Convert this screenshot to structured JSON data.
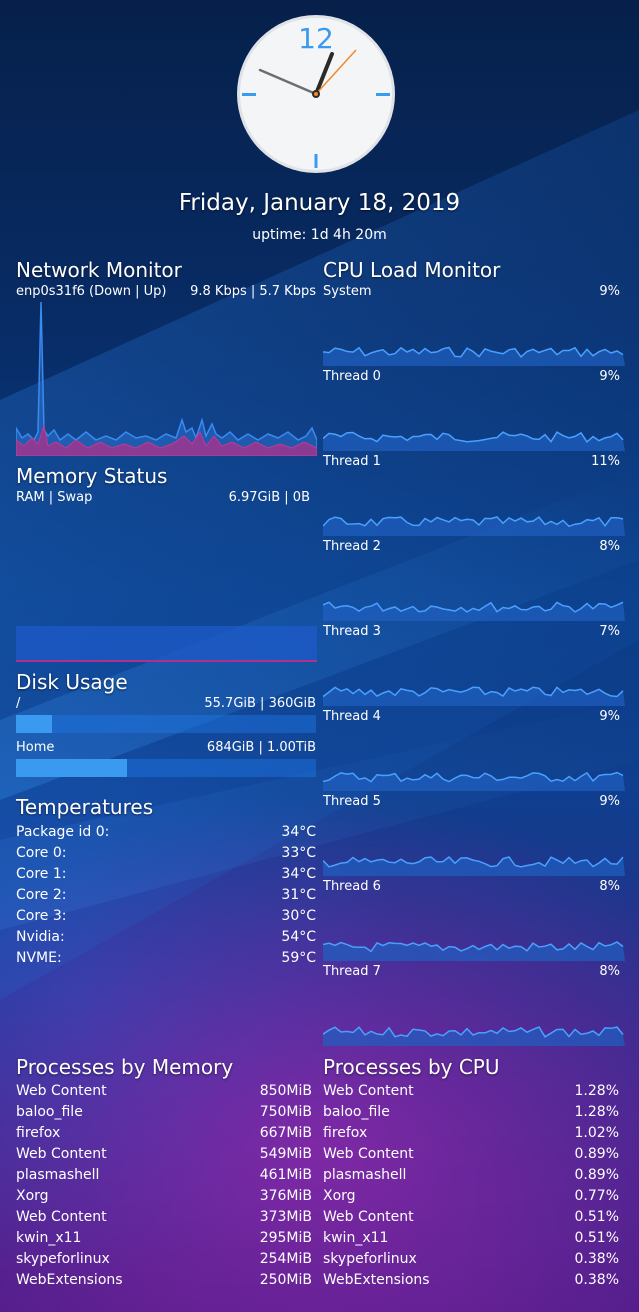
{
  "clock": {
    "numeral": "12"
  },
  "date": "Friday, January 18, 2019",
  "uptime": "uptime: 1d 4h 20m",
  "network": {
    "title": "Network Monitor",
    "interface": "enp0s31f6 (Down | Up)",
    "rates": "9.8 Kbps | 5.7 Kbps",
    "colors": {
      "down": "#3a8af0",
      "up": "#b0308a"
    }
  },
  "memory": {
    "title": "Memory Status",
    "label": "RAM | Swap",
    "value": "6.97GiB | 0B"
  },
  "disk": {
    "title": "Disk Usage",
    "items": [
      {
        "name": "/",
        "value": "55.7GiB | 360GiB",
        "fraction": 0.12
      },
      {
        "name": "Home",
        "value": "684GiB | 1.00TiB",
        "fraction": 0.37
      }
    ]
  },
  "temps": {
    "title": "Temperatures",
    "items": [
      {
        "name": "Package id 0:",
        "value": "34°C"
      },
      {
        "name": "Core 0:",
        "value": "33°C"
      },
      {
        "name": "Core 1:",
        "value": "34°C"
      },
      {
        "name": "Core 2:",
        "value": "31°C"
      },
      {
        "name": "Core 3:",
        "value": "30°C"
      },
      {
        "name": "Nvidia:",
        "value": "54°C"
      },
      {
        "name": "NVME:",
        "value": "59°C"
      }
    ]
  },
  "cpu": {
    "title": "CPU Load Monitor",
    "rows": [
      {
        "name": "System",
        "value": "9%"
      },
      {
        "name": "Thread 0",
        "value": "9%"
      },
      {
        "name": "Thread 1",
        "value": "11%"
      },
      {
        "name": "Thread 2",
        "value": "8%"
      },
      {
        "name": "Thread 3",
        "value": "7%"
      },
      {
        "name": "Thread 4",
        "value": "9%"
      },
      {
        "name": "Thread 5",
        "value": "9%"
      },
      {
        "name": "Thread 6",
        "value": "8%"
      },
      {
        "name": "Thread 7",
        "value": "8%"
      }
    ]
  },
  "proc_mem": {
    "title": "Processes by Memory",
    "items": [
      {
        "name": "Web Content",
        "value": "850MiB"
      },
      {
        "name": "baloo_file",
        "value": "750MiB"
      },
      {
        "name": "firefox",
        "value": "667MiB"
      },
      {
        "name": "Web Content",
        "value": "549MiB"
      },
      {
        "name": "plasmashell",
        "value": "461MiB"
      },
      {
        "name": "Xorg",
        "value": "376MiB"
      },
      {
        "name": "Web Content",
        "value": "373MiB"
      },
      {
        "name": "kwin_x11",
        "value": "295MiB"
      },
      {
        "name": "skypeforlinux",
        "value": "254MiB"
      },
      {
        "name": "WebExtensions",
        "value": "250MiB"
      }
    ]
  },
  "proc_cpu": {
    "title": "Processes by CPU",
    "items": [
      {
        "name": "Web Content",
        "value": "1.28%"
      },
      {
        "name": "baloo_file",
        "value": "1.28%"
      },
      {
        "name": "firefox",
        "value": "1.02%"
      },
      {
        "name": "Web Content",
        "value": "0.89%"
      },
      {
        "name": "plasmashell",
        "value": "0.89%"
      },
      {
        "name": "Xorg",
        "value": "0.77%"
      },
      {
        "name": "Web Content",
        "value": "0.51%"
      },
      {
        "name": "kwin_x11",
        "value": "0.51%"
      },
      {
        "name": "skypeforlinux",
        "value": "0.38%"
      },
      {
        "name": "WebExtensions",
        "value": "0.38%"
      }
    ]
  },
  "colors": {
    "accent": "#3a9af0",
    "graph_fill": "#1f5fc0",
    "graph_line": "#4aa0ff"
  }
}
